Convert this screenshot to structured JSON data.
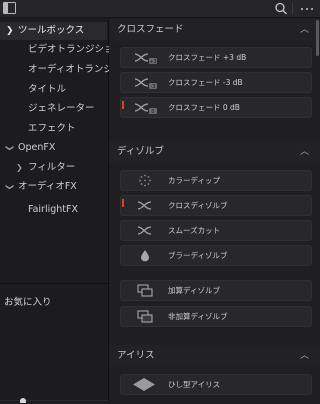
{
  "sidebar": {
    "items": [
      {
        "label": "ツールボックス",
        "expanded": true
      },
      {
        "label": "ビデオトランジション"
      },
      {
        "label": "オーディオトランジ..."
      },
      {
        "label": "タイトル"
      },
      {
        "label": "ジェネレーター"
      },
      {
        "label": "エフェクト"
      },
      {
        "label": "OpenFX",
        "expanded": true
      },
      {
        "label": "フィルター",
        "expanded": false
      },
      {
        "label": "オーディオFX",
        "expanded": true
      },
      {
        "label": "FairlightFX"
      }
    ],
    "favorites_label": "お気に入り"
  },
  "sections": [
    {
      "title": "クロスフェード",
      "items": [
        {
          "label": "クロスフェード +3 dB",
          "icon": "crossfade-plus-icon",
          "marked": false
        },
        {
          "label": "クロスフェード -3 dB",
          "icon": "crossfade-minus-icon",
          "marked": false
        },
        {
          "label": "クロスフェード 0 dB",
          "icon": "crossfade-zero-icon",
          "marked": true
        }
      ]
    },
    {
      "title": "ディゾルブ",
      "items": [
        {
          "label": "カラーディップ",
          "icon": "dots-icon",
          "marked": false
        },
        {
          "label": "クロスディゾルブ",
          "icon": "cross-dissolve-icon",
          "marked": true
        },
        {
          "label": "スムーズカット",
          "icon": "smooth-cut-icon",
          "marked": false
        },
        {
          "label": "ブラーディゾルブ",
          "icon": "drop-icon",
          "marked": false
        },
        {
          "label": "加算ディゾルブ",
          "icon": "additive-dissolve-icon",
          "marked": false
        },
        {
          "label": "非加算ディゾルブ",
          "icon": "non-additive-dissolve-icon",
          "marked": false
        }
      ]
    },
    {
      "title": "アイリス",
      "items": [
        {
          "label": "ひし型アイリス",
          "icon": "diamond-iris-icon",
          "marked": false
        }
      ]
    }
  ],
  "colors": {
    "accent_red": "#e03b3b",
    "background": "#1f1f22",
    "text": "#d0d0d0"
  }
}
